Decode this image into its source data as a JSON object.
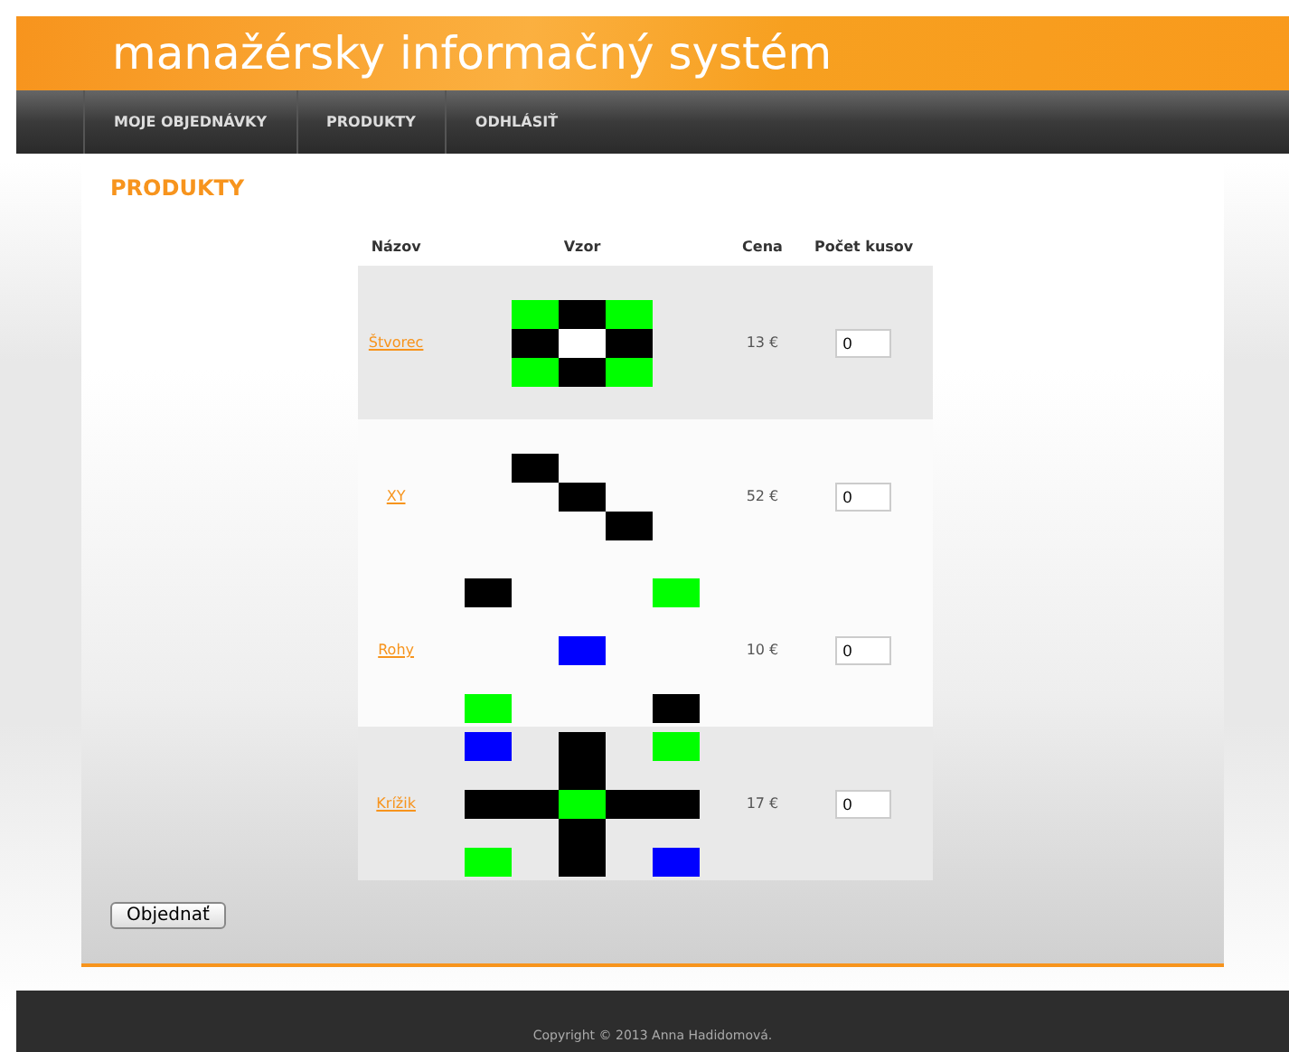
{
  "header": {
    "title": "manažérsky informačný systém"
  },
  "nav": [
    {
      "label": "MOJE OBJEDNÁVKY"
    },
    {
      "label": "PRODUKTY"
    },
    {
      "label": "ODHLÁSIŤ"
    }
  ],
  "page_title": "PRODUKTY",
  "table": {
    "columns": [
      "Názov",
      "Vzor",
      "Cena",
      "Počet kusov"
    ],
    "rows": [
      {
        "name": "Štvorec",
        "price": "13 €",
        "quantity": "0",
        "highlighted": true,
        "pattern": [
          [
            {
              "kind": "filled",
              "color": "#00ff00"
            },
            {
              "kind": "filled",
              "color": "#000000"
            },
            {
              "kind": "filled",
              "color": "#00ff00"
            }
          ],
          [
            {
              "kind": "filled",
              "color": "#000000"
            },
            {
              "kind": "filled",
              "color": "#ffffff"
            },
            {
              "kind": "filled",
              "color": "#000000"
            }
          ],
          [
            {
              "kind": "filled",
              "color": "#00ff00"
            },
            {
              "kind": "filled",
              "color": "#000000"
            },
            {
              "kind": "filled",
              "color": "#00ff00"
            }
          ]
        ]
      },
      {
        "name": "XY",
        "price": "52 €",
        "quantity": "0",
        "highlighted": false,
        "pattern": [
          [
            {
              "kind": "filled",
              "color": "#000000"
            },
            {
              "kind": "empty"
            },
            {
              "kind": "empty"
            }
          ],
          [
            {
              "kind": "empty"
            },
            {
              "kind": "filled",
              "color": "#000000"
            },
            {
              "kind": "empty"
            }
          ],
          [
            {
              "kind": "empty"
            },
            {
              "kind": "empty"
            },
            {
              "kind": "filled",
              "color": "#000000"
            }
          ]
        ]
      },
      {
        "name": "Rohy",
        "price": "10 €",
        "quantity": "0",
        "highlighted": false,
        "pattern": [
          [
            {
              "kind": "filled",
              "color": "#000000"
            },
            {
              "kind": "empty"
            },
            {
              "kind": "empty"
            },
            {
              "kind": "empty"
            },
            {
              "kind": "filled",
              "color": "#00ff00"
            }
          ],
          [
            {
              "kind": "empty"
            },
            {
              "kind": "empty"
            },
            {
              "kind": "empty"
            },
            {
              "kind": "empty"
            },
            {
              "kind": "empty"
            }
          ],
          [
            {
              "kind": "empty"
            },
            {
              "kind": "empty"
            },
            {
              "kind": "filled",
              "color": "#0000ff"
            },
            {
              "kind": "empty"
            },
            {
              "kind": "empty"
            }
          ],
          [
            {
              "kind": "empty"
            },
            {
              "kind": "empty"
            },
            {
              "kind": "empty"
            },
            {
              "kind": "empty"
            },
            {
              "kind": "empty"
            }
          ],
          [
            {
              "kind": "filled",
              "color": "#00ff00"
            },
            {
              "kind": "empty"
            },
            {
              "kind": "empty"
            },
            {
              "kind": "empty"
            },
            {
              "kind": "filled",
              "color": "#000000"
            }
          ]
        ]
      },
      {
        "name": "Krížik",
        "price": "17 €",
        "quantity": "0",
        "highlighted": true,
        "pattern": [
          [
            {
              "kind": "filled",
              "color": "#0000ff"
            },
            {
              "kind": "empty"
            },
            {
              "kind": "filled",
              "color": "#000000"
            },
            {
              "kind": "empty"
            },
            {
              "kind": "filled",
              "color": "#00ff00"
            }
          ],
          [
            {
              "kind": "empty"
            },
            {
              "kind": "empty"
            },
            {
              "kind": "filled",
              "color": "#000000"
            },
            {
              "kind": "empty"
            },
            {
              "kind": "empty"
            }
          ],
          [
            {
              "kind": "filled",
              "color": "#000000"
            },
            {
              "kind": "filled",
              "color": "#000000"
            },
            {
              "kind": "filled",
              "color": "#00ff00"
            },
            {
              "kind": "filled",
              "color": "#000000"
            },
            {
              "kind": "filled",
              "color": "#000000"
            }
          ],
          [
            {
              "kind": "empty"
            },
            {
              "kind": "empty"
            },
            {
              "kind": "filled",
              "color": "#000000"
            },
            {
              "kind": "empty"
            },
            {
              "kind": "empty"
            }
          ],
          [
            {
              "kind": "filled",
              "color": "#00ff00"
            },
            {
              "kind": "empty"
            },
            {
              "kind": "filled",
              "color": "#000000"
            },
            {
              "kind": "empty"
            },
            {
              "kind": "filled",
              "color": "#0000ff"
            }
          ]
        ]
      }
    ]
  },
  "order_button": "Objednať",
  "footer": "Copyright © 2013 Anna Hadidomová."
}
